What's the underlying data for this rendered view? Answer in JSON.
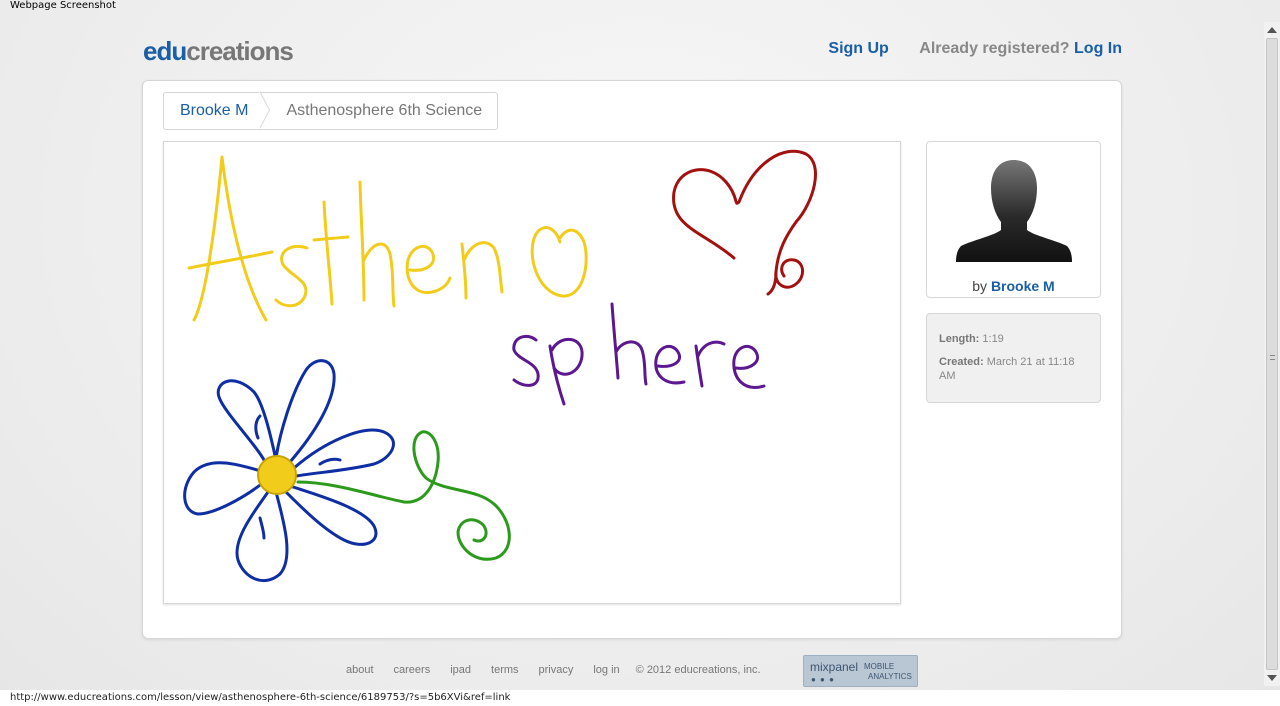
{
  "window": {
    "caption": "Webpage Screenshot"
  },
  "header": {
    "logo_part1": "edu",
    "logo_part2": "creations",
    "signup_label": "Sign Up",
    "already_text": "Already registered?",
    "login_label": "Log In"
  },
  "breadcrumb": {
    "user": "Brooke M",
    "lesson_title": "Asthenosphere 6th Science"
  },
  "whiteboard": {
    "colors": {
      "yellow": "#f2cc1a",
      "red": "#a31010",
      "purple": "#5b1890",
      "blue": "#0f2ea3",
      "green": "#2c9a1c"
    }
  },
  "author": {
    "by_label": "by",
    "name": "Brooke M",
    "avatar_icon": "user-silhouette-icon"
  },
  "meta": {
    "length_label": "Length:",
    "length_value": "1:19",
    "created_label": "Created:",
    "created_value": "March 21 at 11:18 AM"
  },
  "footer": {
    "links": [
      "about",
      "careers",
      "ipad",
      "terms",
      "privacy",
      "log in"
    ],
    "copyright": "© 2012 educreations, inc.",
    "badge_name": "mixpanel",
    "badge_sub1": "MOBILE",
    "badge_sub2": "ANALYTICS"
  },
  "statusbar": {
    "url": "http://www.educreations.com/lesson/view/asthenosphere-6th-science/6189753/?s=5b6XVi&ref=link"
  },
  "accent_color": "#1a5ea3"
}
